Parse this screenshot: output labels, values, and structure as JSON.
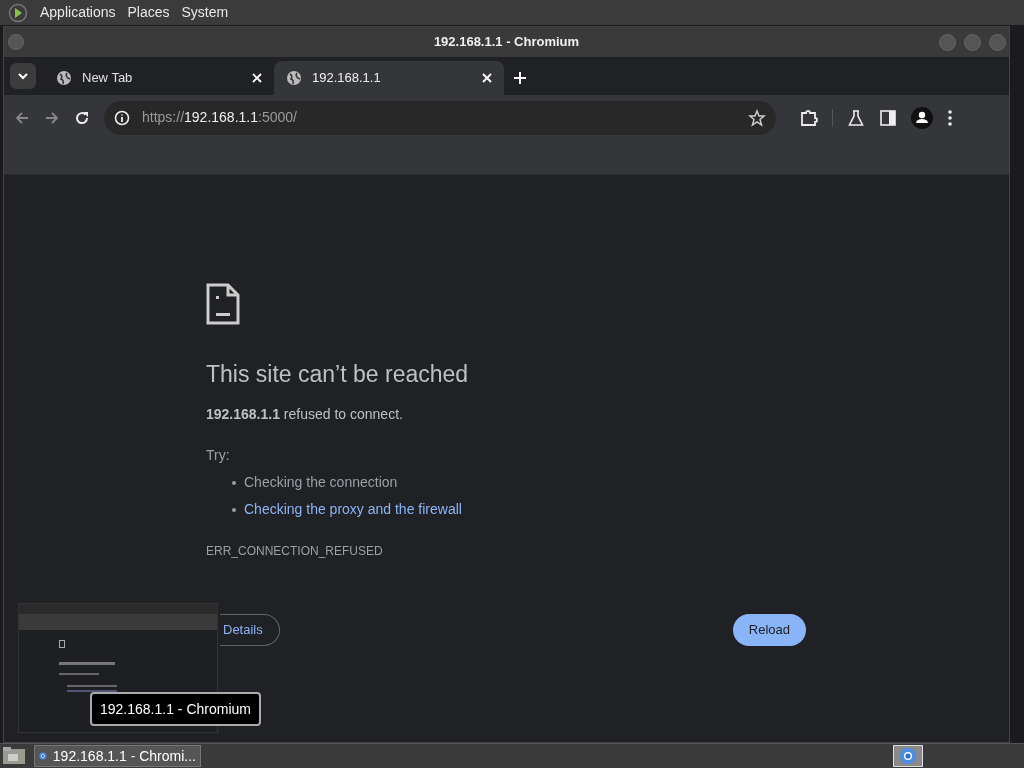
{
  "top_panel": {
    "menus": [
      "Applications",
      "Places",
      "System"
    ]
  },
  "window": {
    "title": "192.168.1.1 - Chromium"
  },
  "tabs": [
    {
      "label": "New Tab",
      "selected": false
    },
    {
      "label": "192.168.1.1",
      "selected": true
    }
  ],
  "toolbar": {
    "url": {
      "scheme": "https://",
      "host": "192.168.1.1",
      "rest": ":5000/"
    }
  },
  "error_page": {
    "heading": "This site can’t be reached",
    "message": "**192.168.1.1** refused to connect.",
    "try_label": "Try:",
    "suggestions": [
      {
        "kind": "text",
        "text": "Checking the connection"
      },
      {
        "kind": "link",
        "text": "Checking the proxy and the firewall"
      }
    ],
    "error_code": "ERR_CONNECTION_REFUSED",
    "details_button": "Details",
    "reload_button": "Reload"
  },
  "tooltip": "192.168.1.1 - Chromium",
  "taskbar": {
    "tasks": [
      {
        "label": "192.168.1.1 - Chromi...",
        "selected": true
      }
    ]
  }
}
